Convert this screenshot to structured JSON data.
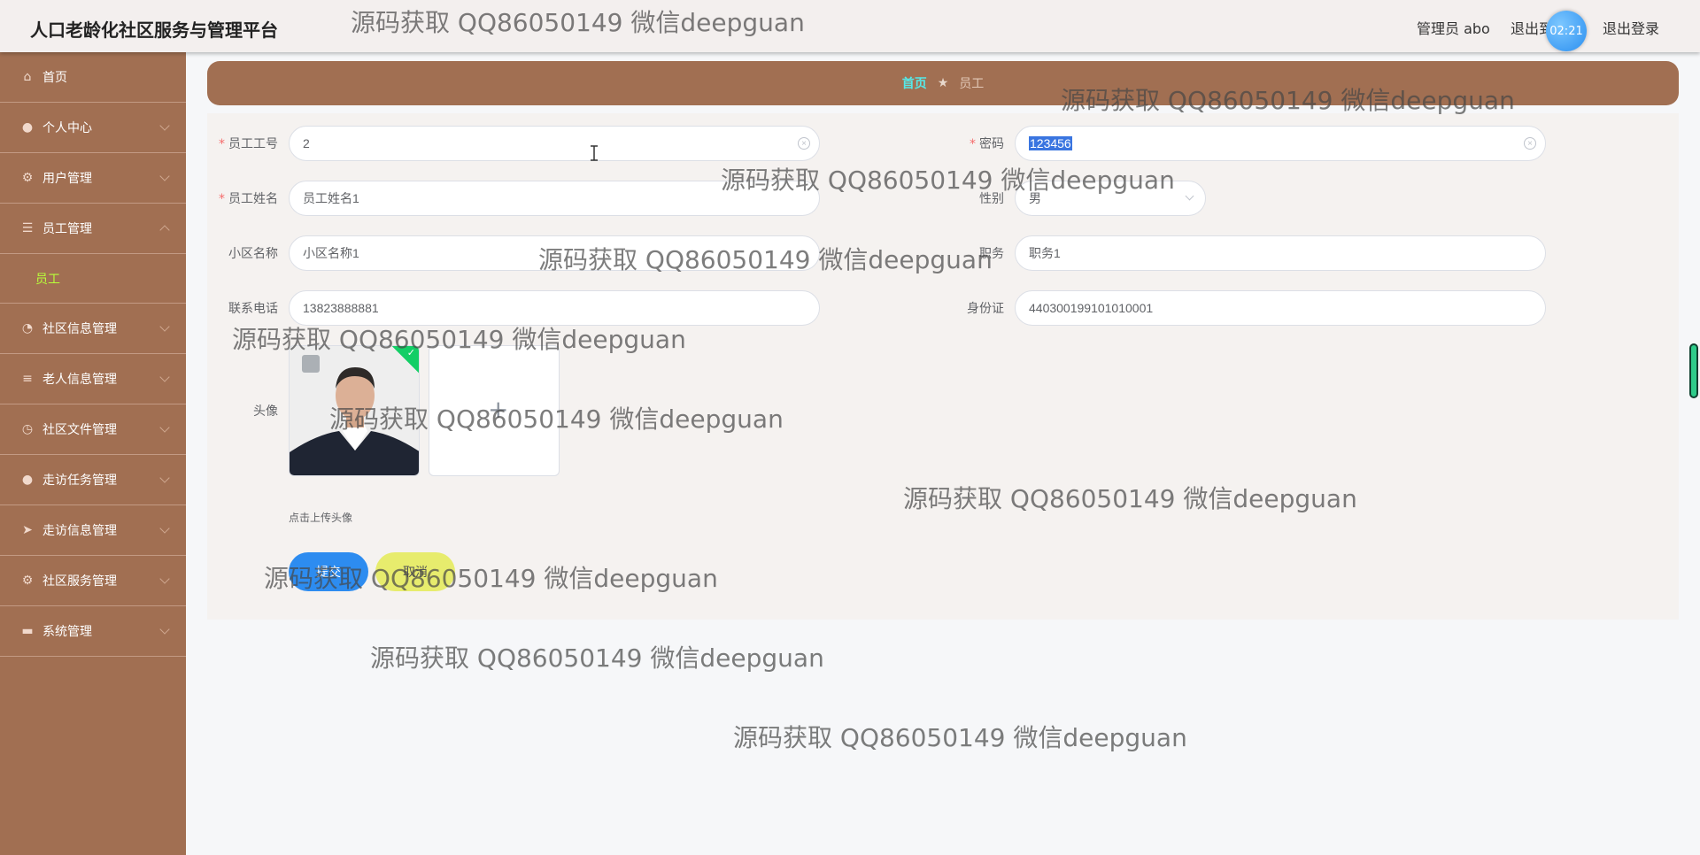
{
  "header": {
    "title": "人口老龄化社区服务与管理平台",
    "user_label": "管理员 abo",
    "logout_short": "退出到",
    "timer": "02:21",
    "logout": "退出登录"
  },
  "sidebar": {
    "items": [
      {
        "label": "首页",
        "icon": "home-icon"
      },
      {
        "label": "个人中心",
        "icon": "user-icon"
      },
      {
        "label": "用户管理",
        "icon": "gear-icon"
      },
      {
        "label": "员工管理",
        "icon": "sliders-icon"
      },
      {
        "label": "社区信息管理",
        "icon": "dial-icon"
      },
      {
        "label": "老人信息管理",
        "icon": "list-icon"
      },
      {
        "label": "社区文件管理",
        "icon": "clock-icon"
      },
      {
        "label": "走访任务管理",
        "icon": "user-icon"
      },
      {
        "label": "走访信息管理",
        "icon": "send-icon"
      },
      {
        "label": "社区服务管理",
        "icon": "gear-icon"
      },
      {
        "label": "系统管理",
        "icon": "chat-icon"
      }
    ],
    "submenu_label": "员工"
  },
  "breadcrumb": {
    "home": "首页",
    "separator": "★",
    "current": "员工"
  },
  "form": {
    "employee_no": {
      "label": "员工工号",
      "value": "2"
    },
    "password": {
      "label": "密码",
      "value": "123456"
    },
    "employee_name": {
      "label": "员工姓名",
      "value": "员工姓名1"
    },
    "gender": {
      "label": "性别",
      "value": "男"
    },
    "community": {
      "label": "小区名称",
      "value": "小区名称1"
    },
    "position": {
      "label": "职务",
      "value": "职务1"
    },
    "phone": {
      "label": "联系电话",
      "value": "13823888881"
    },
    "id_card": {
      "label": "身份证",
      "value": "440300199101010001"
    },
    "avatar": {
      "label": "头像",
      "tip": "点击上传头像",
      "plus": "+"
    },
    "submit_label": "提交",
    "cancel_label": "取消"
  },
  "watermark_text": "源码获取 QQ86050149 微信deepguan"
}
